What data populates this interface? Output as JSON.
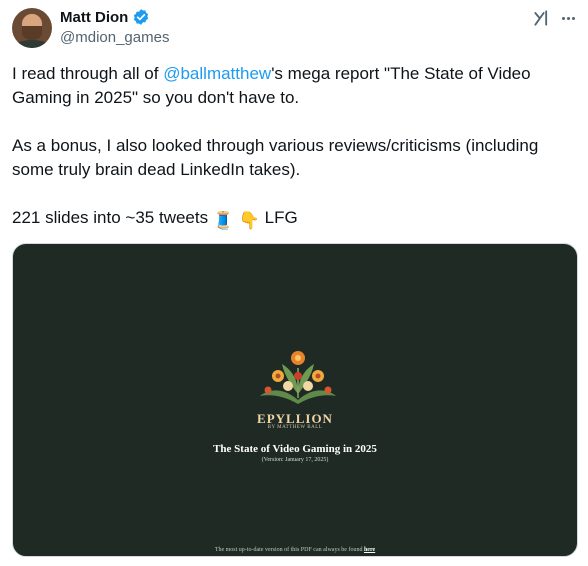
{
  "author": {
    "name": "Matt Dion",
    "handle": "@mdion_games",
    "avatar_icon": "user-avatar",
    "verified_icon": "verified-badge-icon",
    "verified_color": "#1d9bf0"
  },
  "header": {
    "grok_icon": "grok-icon",
    "more_icon": "more-options-icon"
  },
  "tweet": {
    "p1_before": "I read through all of ",
    "p1_mention": "@ballmatthew",
    "p1_after": "'s mega report \"The State of Video Gaming in 2025\" so you don't have to.",
    "p2": "As a bonus, I also looked through various reviews/criticisms (including some truly brain dead LinkedIn takes).",
    "p3_text": "221 slides into ~35 tweets ",
    "p3_emoji1": "🧵",
    "p3_emoji2": "👇",
    "p3_end": " LFG",
    "mention_color": "#1d9bf0"
  },
  "media": {
    "background_color": "#1f2a25",
    "logo_icon": "floral-logo",
    "brand": "EPYLLION",
    "byline": "By Matthew Ball",
    "title": "The State of Video Gaming in 2025",
    "version": "(Version: January 17, 2025)",
    "footer_text": "The most up-to-date version of this PDF can always be found ",
    "footer_link": "here"
  }
}
